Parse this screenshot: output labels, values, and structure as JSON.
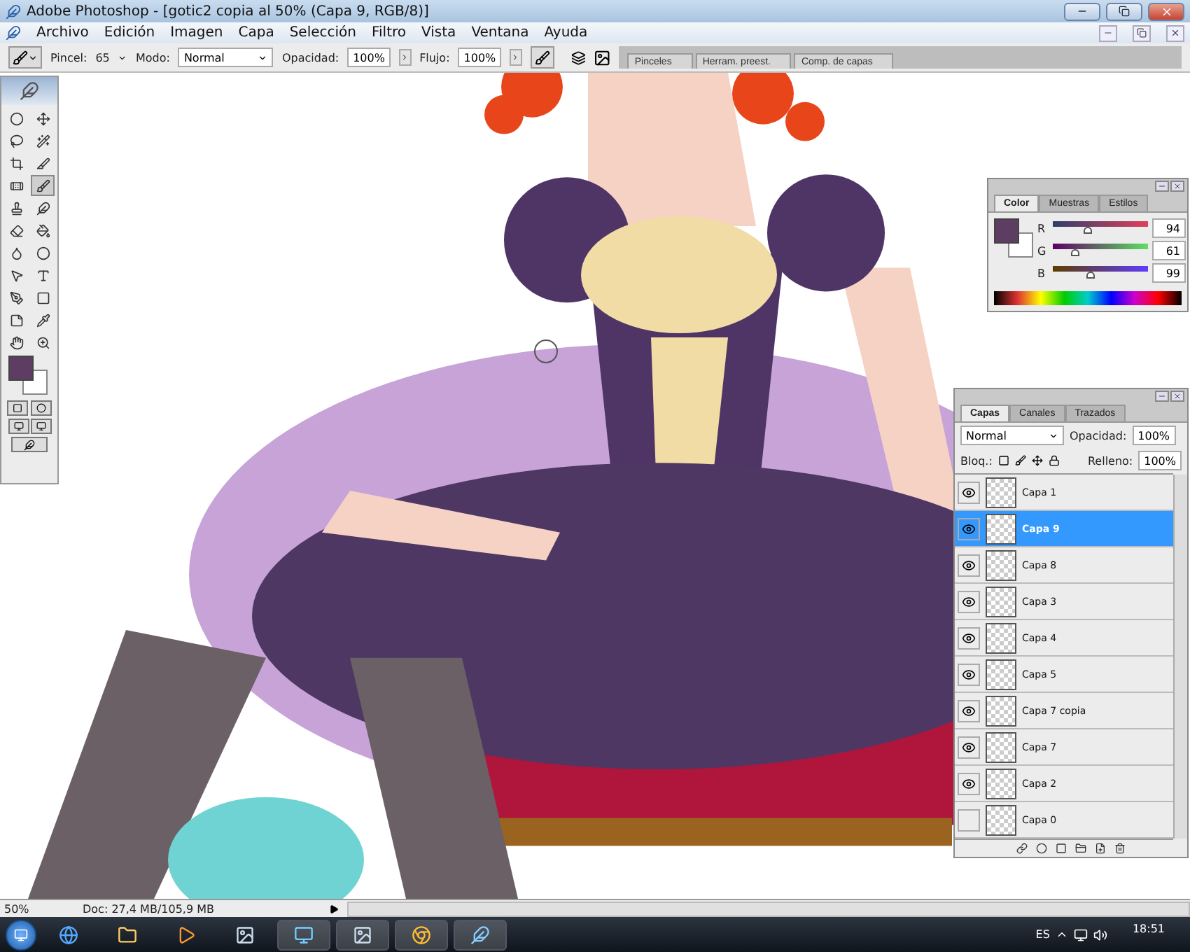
{
  "window": {
    "title": "Adobe Photoshop - [gotic2 copia al 50% (Capa 9, RGB/8)]"
  },
  "menu": [
    "Archivo",
    "Edición",
    "Imagen",
    "Capa",
    "Selección",
    "Filtro",
    "Vista",
    "Ventana",
    "Ayuda"
  ],
  "options_bar": {
    "brush_label": "Pincel:",
    "brush_size": "65",
    "mode_label": "Modo:",
    "mode": "Normal",
    "opacity_label": "Opacidad:",
    "opacity": "100%",
    "flow_label": "Flujo:",
    "flow": "100%"
  },
  "palette_well_tabs": [
    "Pinceles",
    "Herram. preest.",
    "Comp. de capas"
  ],
  "toolbox": {
    "tools": [
      {
        "selected": false
      },
      {
        "selected": false
      },
      {
        "selected": false
      },
      {
        "selected": false
      },
      {
        "selected": false
      },
      {
        "selected": false
      },
      {
        "selected": false
      },
      {
        "selected": true
      },
      {
        "selected": false
      },
      {
        "selected": false
      },
      {
        "selected": false
      },
      {
        "selected": false
      },
      {
        "selected": false
      },
      {
        "selected": false
      },
      {
        "selected": false
      },
      {
        "selected": false
      },
      {
        "selected": false
      },
      {
        "selected": false
      },
      {
        "selected": false
      },
      {
        "selected": false
      },
      {
        "selected": false
      },
      {
        "selected": false
      }
    ]
  },
  "color_panel": {
    "tabs": [
      {
        "label": "Color",
        "selected": true
      },
      {
        "label": "Muestras",
        "selected": false
      },
      {
        "label": "Estilos",
        "selected": false
      }
    ],
    "channels": [
      {
        "name": "R",
        "level": 0.37,
        "value": "94"
      },
      {
        "name": "G",
        "level": 0.24,
        "value": "61"
      },
      {
        "name": "B",
        "level": 0.39,
        "value": "99"
      }
    ]
  },
  "layers_panel": {
    "tabs": [
      {
        "label": "Capas",
        "selected": true
      },
      {
        "label": "Canales",
        "selected": false
      },
      {
        "label": "Trazados",
        "selected": false
      }
    ],
    "blend_mode": "Normal",
    "opacity_label": "Opacidad:",
    "opacity": "100%",
    "lock_label": "Bloq.:",
    "fill_label": "Relleno:",
    "fill": "100%",
    "layers": [
      {
        "name": "Capa 1",
        "visible": true,
        "selected": false
      },
      {
        "name": "Capa 9",
        "visible": true,
        "selected": true
      },
      {
        "name": "Capa 8",
        "visible": true,
        "selected": false
      },
      {
        "name": "Capa 3",
        "visible": true,
        "selected": false
      },
      {
        "name": "Capa 4",
        "visible": true,
        "selected": false
      },
      {
        "name": "Capa 5",
        "visible": true,
        "selected": false
      },
      {
        "name": "Capa 7 copia",
        "visible": true,
        "selected": false
      },
      {
        "name": "Capa 7",
        "visible": true,
        "selected": false
      },
      {
        "name": "Capa 2",
        "visible": true,
        "selected": false
      },
      {
        "name": "Capa 0",
        "visible": false,
        "selected": false
      }
    ]
  },
  "status_bar": {
    "zoom": "50%",
    "doc_info": "Doc: 27,4 MB/105,9 MB"
  },
  "taskbar": {
    "language": "ES",
    "time": "18:51"
  }
}
